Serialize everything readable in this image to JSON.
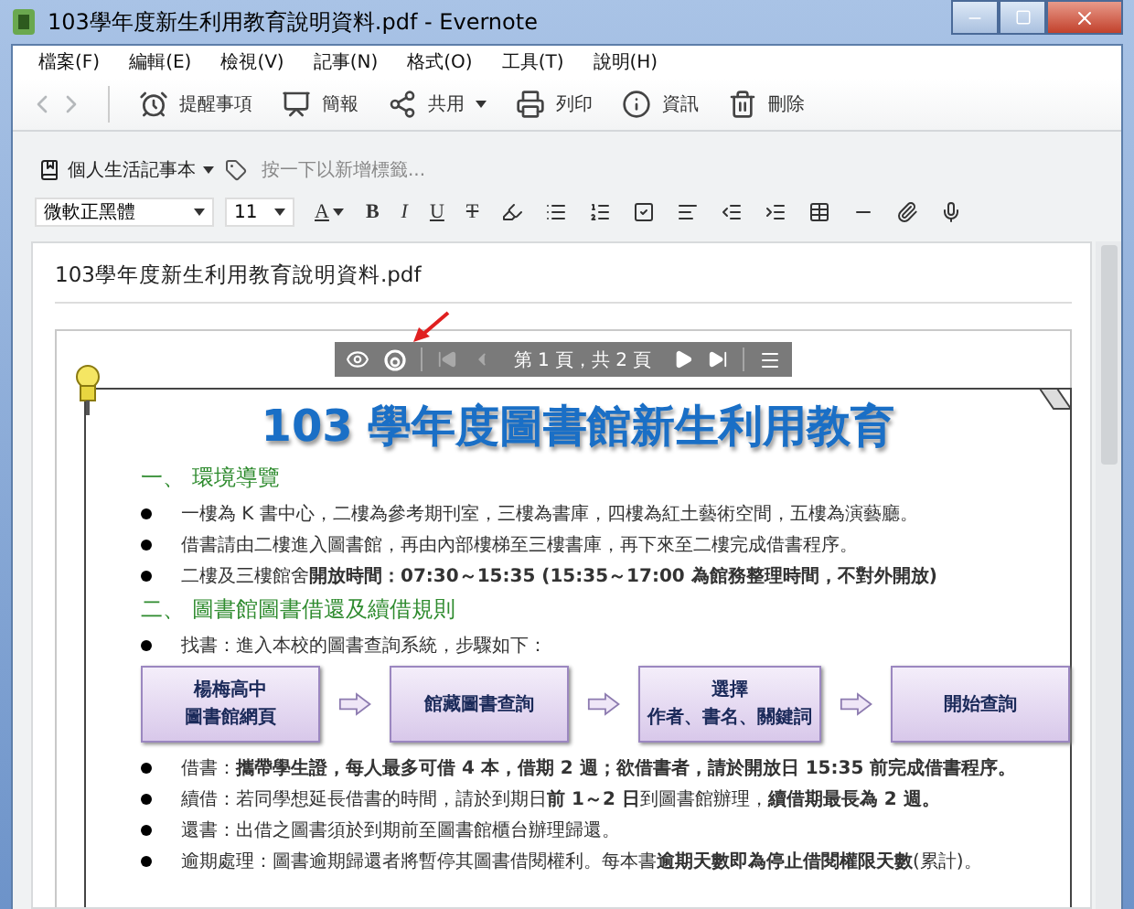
{
  "window": {
    "title": "103學年度新生利用教育說明資料.pdf - Evernote"
  },
  "menu": [
    "檔案(F)",
    "編輯(E)",
    "檢視(V)",
    "記事(N)",
    "格式(O)",
    "工具(T)",
    "說明(H)"
  ],
  "nav": [
    {
      "kind": "back",
      "disabled": true
    },
    {
      "kind": "forward",
      "disabled": true
    }
  ],
  "toolbar": [
    {
      "kind": "reminder",
      "label": "提醒事項",
      "dropdown": false
    },
    {
      "kind": "present",
      "label": "簡報",
      "dropdown": false
    },
    {
      "kind": "share",
      "label": "共用",
      "dropdown": true
    },
    {
      "kind": "print",
      "label": "列印",
      "dropdown": false
    },
    {
      "kind": "info",
      "label": "資訊",
      "dropdown": false
    },
    {
      "kind": "delete",
      "label": "刪除",
      "dropdown": false
    }
  ],
  "notebook": {
    "label": "個人生活記事本"
  },
  "tags": {
    "placeholder": "按一下以新增標籤..."
  },
  "format": {
    "font": "微軟正黑體",
    "size": "11",
    "buttons": [
      {
        "kind": "color",
        "label": "A"
      },
      {
        "kind": "bold",
        "label": "B"
      },
      {
        "kind": "italic",
        "label": "I"
      },
      {
        "kind": "underline",
        "label": "U"
      },
      {
        "kind": "strike",
        "label": "T"
      },
      {
        "kind": "highlight"
      },
      {
        "kind": "bullets"
      },
      {
        "kind": "numbers"
      },
      {
        "kind": "checkbox"
      },
      {
        "kind": "align"
      },
      {
        "kind": "outdent"
      },
      {
        "kind": "indent"
      },
      {
        "kind": "table"
      },
      {
        "kind": "rule"
      },
      {
        "kind": "attach"
      },
      {
        "kind": "mic"
      }
    ]
  },
  "note": {
    "title": "103學年度新生利用教育說明資料.pdf"
  },
  "pdf_toolbar": {
    "page": "第 1 頁，共 2 頁",
    "buttons": [
      {
        "kind": "first",
        "disabled": true
      },
      {
        "kind": "prev",
        "disabled": true
      },
      {
        "kind": "next",
        "disabled": false
      },
      {
        "kind": "last",
        "disabled": false
      }
    ]
  },
  "document": {
    "title": "103 學年度圖書館新生利用教育",
    "sections": [
      {
        "heading": "一、 環境導覽",
        "items": [
          {
            "kind": "bullet",
            "text": "一樓為 K 書中心，二樓為參考期刊室，三樓為書庫，四樓為紅土藝術空間，五樓為演藝廳。"
          },
          {
            "kind": "bullet",
            "text": "借書請由二樓進入圖書館，再由內部樓梯至三樓書庫，再下來至二樓完成借書程序。"
          },
          {
            "kind": "bullet",
            "text": "二樓及三樓館舍**開放時間：07:30～15:35 (15:35～17:00 為館務整理時間，不對外開放)**"
          }
        ]
      },
      {
        "heading": "二、 圖書館圖書借還及續借規則",
        "items": [
          {
            "kind": "bullet",
            "text": "找書：進入本校的圖書查詢系統，步驟如下："
          },
          {
            "kind": "flow",
            "steps": [
              [
                "楊梅高中",
                "圖書館網頁"
              ],
              [
                "館藏圖書查詢"
              ],
              [
                "選擇",
                "作者、書名、關鍵詞"
              ],
              [
                "開始查詢"
              ]
            ]
          },
          {
            "kind": "bullet",
            "text": "借書：**攜帶學生證，每人最多可借 4 本，借期 2 週；欲借書者，請於開放日 15:35 前完成借書程序。**"
          },
          {
            "kind": "bullet",
            "text": "續借：若同學想延長借書的時間，請於到期日**前 1～2 日**到圖書館辦理，**續借期最長為 2 週。**"
          },
          {
            "kind": "bullet",
            "text": "還書：出借之圖書須於到期前至圖書館櫃台辦理歸還。"
          },
          {
            "kind": "bullet",
            "text": "逾期處理：圖書逾期歸還者將暫停其圖書借閱權利。每本書**逾期天數即為停止借閱權限天數**(累計)。"
          }
        ]
      }
    ]
  }
}
